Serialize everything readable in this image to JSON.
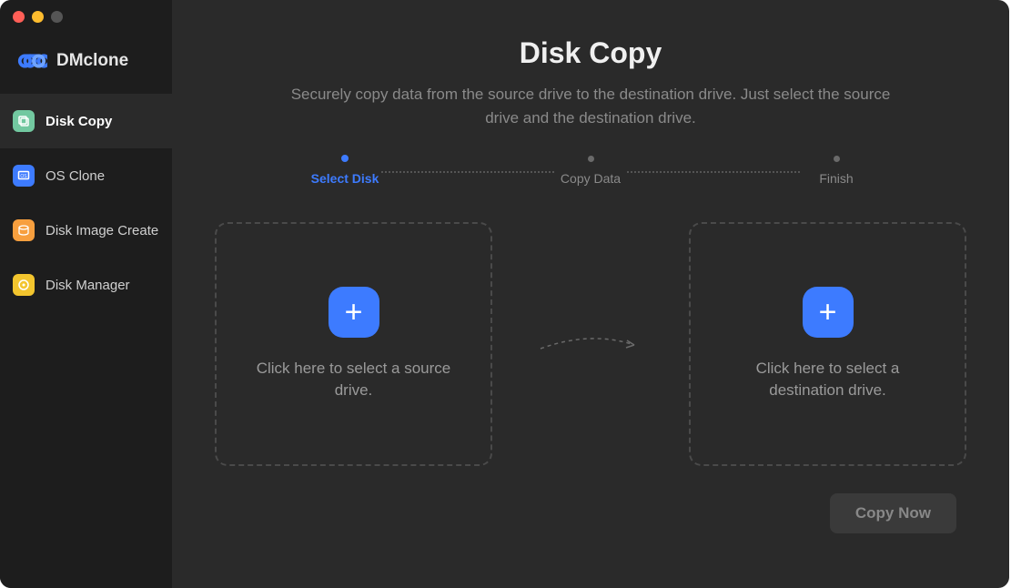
{
  "brand": {
    "name": "DMclone"
  },
  "sidebar": {
    "items": [
      {
        "label": "Disk Copy"
      },
      {
        "label": "OS Clone"
      },
      {
        "label": "Disk Image Create"
      },
      {
        "label": "Disk Manager"
      }
    ]
  },
  "page": {
    "title": "Disk Copy",
    "subtitle": "Securely copy data from the source drive to the destination drive. Just select the source drive and the destination drive."
  },
  "steps": [
    {
      "label": "Select Disk"
    },
    {
      "label": "Copy Data"
    },
    {
      "label": "Finish"
    }
  ],
  "drives": {
    "source_caption": "Click here to select a source drive.",
    "destination_caption": "Click here to select a destination drive."
  },
  "actions": {
    "copy_now": "Copy Now"
  }
}
